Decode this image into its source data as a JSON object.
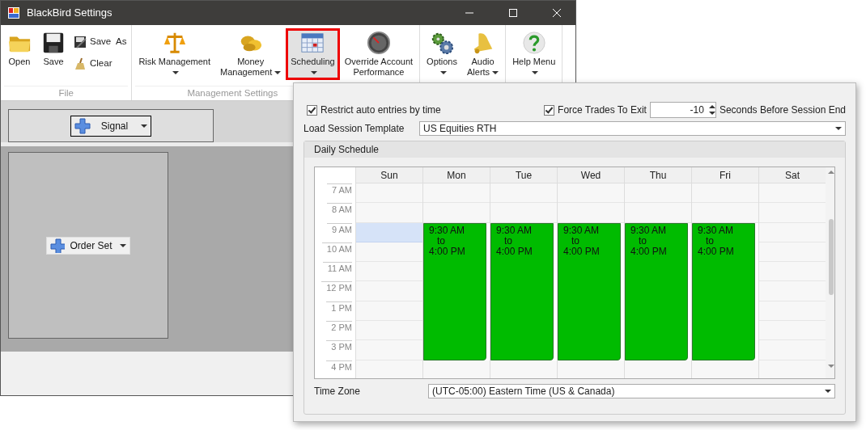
{
  "window": {
    "title": "BlackBird Settings"
  },
  "ribbon": {
    "groups": [
      {
        "label": "File",
        "items": [
          {
            "kind": "large",
            "label": "Open",
            "selected": false
          },
          {
            "kind": "large",
            "label": "Save",
            "selected": false
          },
          {
            "kind": "small",
            "label": "Save  As",
            "selected": false
          },
          {
            "kind": "small",
            "label": "Clear",
            "selected": false
          }
        ]
      },
      {
        "label": "Management Settings",
        "items": [
          {
            "kind": "large",
            "label": "Risk Management",
            "dropdown": true,
            "selected": false
          },
          {
            "kind": "large",
            "label": "Money\nManagement",
            "dropdown": true,
            "selected": false
          },
          {
            "kind": "large",
            "label": "Scheduling",
            "dropdown": true,
            "selected": true
          },
          {
            "kind": "large",
            "label": "Override Account\nPerformance",
            "selected": false
          }
        ]
      },
      {
        "items": [
          {
            "kind": "large",
            "label": "Options",
            "dropdown": true,
            "selected": false
          },
          {
            "kind": "large",
            "label": "Audio\nAlerts",
            "dropdown": true,
            "selected": false
          }
        ]
      },
      {
        "items": [
          {
            "kind": "large",
            "label": "Help Menu",
            "dropdown": true,
            "selected": false
          }
        ]
      }
    ]
  },
  "signal_button": {
    "label": "Signal"
  },
  "order_set_button": {
    "label": "Order Set"
  },
  "schedule": {
    "restrict_entries": {
      "label": "Restrict auto entries by time",
      "checked": true
    },
    "force_exit": {
      "label": "Force Trades To Exit",
      "checked": true,
      "value": "-10",
      "suffix": "Seconds Before Session End"
    },
    "template": {
      "label": "Load Session Template",
      "value": "US Equities RTH"
    },
    "group_title": "Daily Schedule",
    "hours": [
      "7 AM",
      "8 AM",
      "9 AM",
      "10 AM",
      "11 AM",
      "12 PM",
      "1 PM",
      "2 PM",
      "3 PM",
      "4 PM"
    ],
    "days": [
      {
        "label": "Sun",
        "selected": true
      },
      {
        "label": "Mon",
        "selected": false,
        "events": [
          {
            "start": "9:30 AM",
            "joiner": "to",
            "end": "4:00 PM",
            "color": "#00bb00"
          }
        ]
      },
      {
        "label": "Tue",
        "selected": false,
        "events": [
          {
            "start": "9:30 AM",
            "joiner": "to",
            "end": "4:00 PM",
            "color": "#00bb00"
          }
        ]
      },
      {
        "label": "Wed",
        "selected": false,
        "events": [
          {
            "start": "9:30 AM",
            "joiner": "to",
            "end": "4:00 PM",
            "color": "#00bb00"
          }
        ]
      },
      {
        "label": "Thu",
        "selected": false,
        "events": [
          {
            "start": "9:30 AM",
            "joiner": "to",
            "end": "4:00 PM",
            "color": "#00bb00"
          }
        ]
      },
      {
        "label": "Fri",
        "selected": false,
        "events": [
          {
            "start": "9:30 AM",
            "joiner": "to",
            "end": "4:00 PM",
            "color": "#00bb00"
          }
        ]
      },
      {
        "label": "Sat",
        "selected": false
      }
    ],
    "time_zone": {
      "label": "Time Zone",
      "value": "(UTC-05:00) Eastern Time (US & Canada)"
    }
  }
}
